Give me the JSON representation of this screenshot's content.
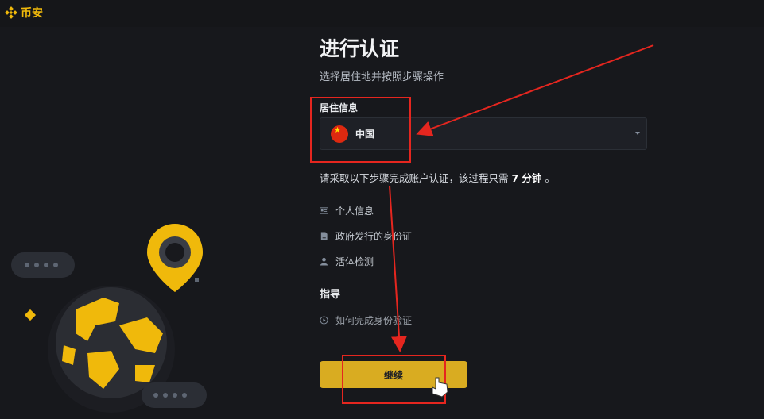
{
  "app": {
    "logo_text": "币安"
  },
  "page": {
    "title": "进行认证",
    "subtitle": "选择居住地并按照步骤操作"
  },
  "residence": {
    "label": "居住信息",
    "selected_value": "中国"
  },
  "notice": {
    "prefix": "请采取以下步骤完成账户认证，该过程只需",
    "duration": "7 分钟",
    "suffix": "。"
  },
  "steps": [
    {
      "label": "个人信息",
      "icon": "id-card-icon"
    },
    {
      "label": "政府发行的身份证",
      "icon": "document-icon"
    },
    {
      "label": "活体检测",
      "icon": "person-icon"
    }
  ],
  "guide": {
    "title": "指导",
    "link_label": "如何完成身份验证",
    "link_icon": "play-circle-icon"
  },
  "actions": {
    "continue_label": "继续"
  },
  "colors": {
    "brand": "#F0B90B",
    "button": "#D9AC21",
    "annotation": "#E5261F",
    "background": "#17181C"
  }
}
